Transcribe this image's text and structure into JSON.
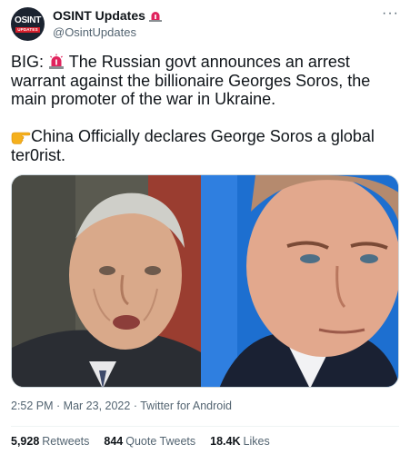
{
  "author": {
    "name": "OSINT Updates",
    "handle": "@OsintUpdates",
    "avatar_text": "OSINT",
    "avatar_subtext": "UPDATES",
    "badge_icon": "police-siren-icon"
  },
  "menu_icon": "more-options-icon",
  "tweet": {
    "line1_prefix": "BIG:",
    "line1_rest": " The Russian govt announces an arrest warrant against the billionaire Georges Soros, the main promoter of the war in Ukraine.",
    "line2_rest": "China Officially declares George Soros a global ter0rist.",
    "emoji_1": "police-siren-icon",
    "emoji_2": "pointing-hand-icon"
  },
  "media": {
    "left_photo": "photo-george-soros",
    "right_photo": "photo-vladimir-putin"
  },
  "meta": {
    "time": "2:52 PM",
    "separator": " · ",
    "date": "Mar 23, 2022",
    "source": "Twitter for Android"
  },
  "stats": {
    "retweets_count": "5,928",
    "retweets_label": "Retweets",
    "quotes_count": "844",
    "quotes_label": "Quote Tweets",
    "likes_count": "18.4K",
    "likes_label": "Likes"
  },
  "colors": {
    "text": "#0f1419",
    "secondary": "#536471",
    "siren_red": "#e0245e",
    "divider": "#eff3f4"
  }
}
